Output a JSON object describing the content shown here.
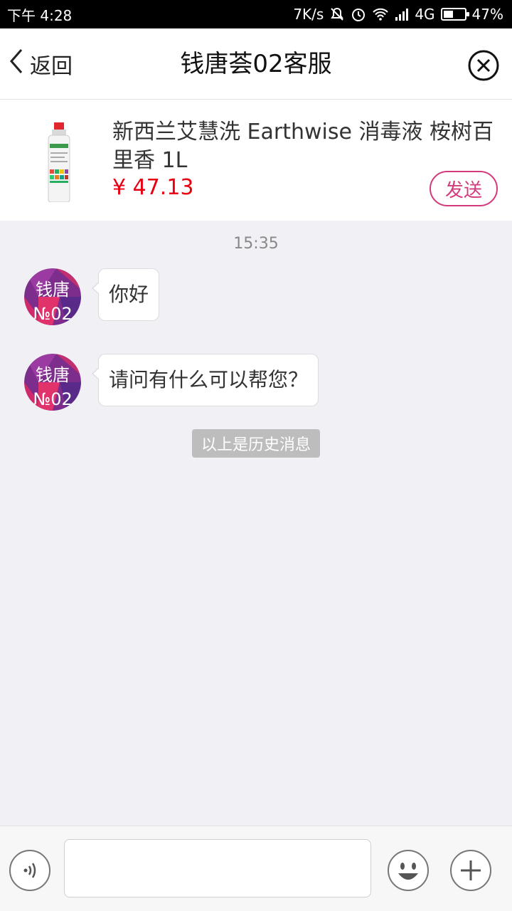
{
  "status_bar": {
    "time": "下午 4:28",
    "net_speed": "7K/s",
    "network": "4G",
    "battery_text": "47%",
    "battery_level": 0.47
  },
  "header": {
    "back_label": "返回",
    "title": "钱唐荟02客服"
  },
  "product": {
    "title": "新西兰艾慧洗 Earthwise 消毒液 桉树百里香 1L",
    "price": "¥ 47.13",
    "send_label": "发送"
  },
  "chat": {
    "timestamp": "15:35",
    "avatar_text_top": "钱唐",
    "avatar_text_bottom": "№02",
    "messages": [
      {
        "text": "你好"
      },
      {
        "text": "请问有什么可以帮您？"
      }
    ],
    "history_label": "以上是历史消息"
  },
  "input_bar": {
    "placeholder": "",
    "voice_icon": "voice-icon",
    "emoji_icon": "emoji-icon",
    "plus_icon": "plus-icon"
  },
  "colors": {
    "accent": "#d33a7b",
    "price": "#e60012",
    "chat_bg": "#f0f0f5"
  }
}
